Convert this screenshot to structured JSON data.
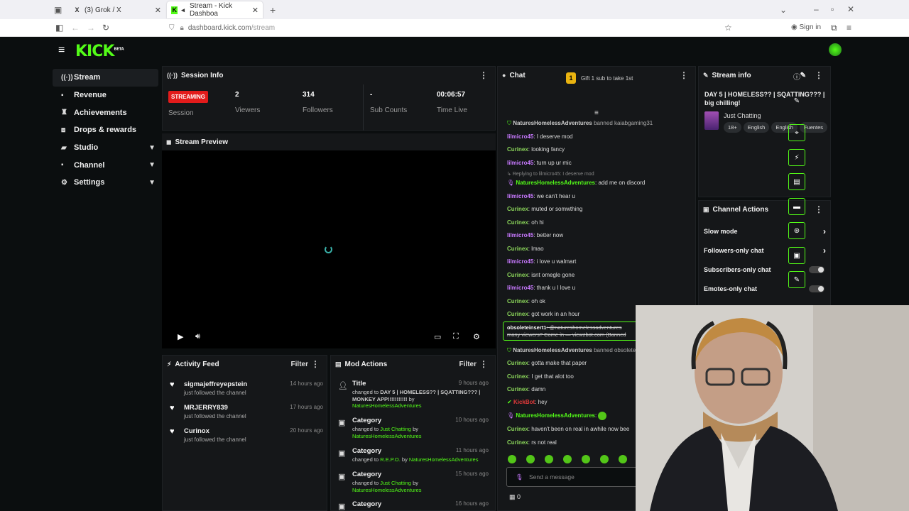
{
  "browser": {
    "tabs": [
      {
        "title": "(3) Grok / X"
      },
      {
        "title": "Stream - Kick Dashboa"
      }
    ],
    "url_host": "dashboard.kick.com",
    "url_path": "/stream",
    "sign_in": "Sign in"
  },
  "app": {
    "logo": "KICK",
    "logo_badge": "BETA"
  },
  "sidebar": {
    "items": [
      {
        "label": "Stream"
      },
      {
        "label": "Revenue"
      },
      {
        "label": "Achievements"
      },
      {
        "label": "Drops & rewards"
      },
      {
        "label": "Studio"
      },
      {
        "label": "Channel"
      },
      {
        "label": "Settings"
      }
    ]
  },
  "session": {
    "title": "Session Info",
    "status": "STREAMING",
    "session_label": "Session",
    "viewers_value": "2",
    "viewers_label": "Viewers",
    "followers_value": "314",
    "followers_label": "Followers",
    "subs_value": "-",
    "subs_label": "Sub Counts",
    "time_value": "00:06:57",
    "time_label": "Time Live"
  },
  "preview": {
    "title": "Stream Preview"
  },
  "activity": {
    "title": "Activity Feed",
    "filter": "Filter",
    "items": [
      {
        "name": "sigmajeffreyepstein",
        "sub": "just followed the channel",
        "time": "14 hours ago"
      },
      {
        "name": "MRJERRY839",
        "sub": "just followed the channel",
        "time": "17 hours ago"
      },
      {
        "name": "Curinox",
        "sub": "just followed the channel",
        "time": "20 hours ago"
      }
    ]
  },
  "mod": {
    "title": "Mod Actions",
    "filter": "Filter",
    "items": [
      {
        "title": "Title",
        "time": "9 hours ago",
        "pre": "changed to ",
        "value": "DAY 5 | HOMELESS?? | SQATTING??? | MONKEY APP!!!!!!!!!!!",
        "by": " by",
        "user": "NaturesHomelessAdventures"
      },
      {
        "title": "Category",
        "time": "10 hours ago",
        "pre": "changed to ",
        "value": "Just Chatting",
        "by": " by",
        "user": "NaturesHomelessAdventures"
      },
      {
        "title": "Category",
        "time": "11 hours ago",
        "pre": "changed to ",
        "value": "R.E.P.O.",
        "by": " by ",
        "user": "NaturesHomelessAdventures"
      },
      {
        "title": "Category",
        "time": "15 hours ago",
        "pre": "changed to ",
        "value": "Just Chatting",
        "by": " by",
        "user": "NaturesHomelessAdventures"
      },
      {
        "title": "Category",
        "time": "16 hours ago"
      }
    ]
  },
  "chat": {
    "title": "Chat",
    "gift_count": "1",
    "gift_text": "Gift 1 sub to take 1st",
    "messages": [
      {
        "user": "NaturesHomelessAdventures",
        "text": " banned ",
        "target": "kaiabgaming31",
        "type": "ban"
      },
      {
        "user": "lilmicro45",
        "text": ": I deserve mod",
        "type": "u1"
      },
      {
        "user": "Curinex",
        "text": ": looking fancy",
        "type": "u2"
      },
      {
        "user": "lilmicro45",
        "text": ": turn up ur mic",
        "type": "u1"
      },
      {
        "reply": "Replying to lilmicro45: I deserve mod",
        "user": "NaturesHomelessAdventures",
        "text": ": add me on discord",
        "type": "reply"
      },
      {
        "user": "lilmicro45",
        "text": ": we can't hear u",
        "type": "u1"
      },
      {
        "user": "Curinex",
        "text": ": muted or somwthing",
        "type": "u2"
      },
      {
        "user": "Curinex",
        "text": ": oh hi",
        "type": "u2"
      },
      {
        "user": "lilmicro45",
        "text": ": better now",
        "type": "u1"
      },
      {
        "user": "Curinex",
        "text": ": lmao",
        "type": "u2"
      },
      {
        "user": "lilmicro45",
        "text": ": i love u walmart",
        "type": "u1"
      },
      {
        "user": "Curinex",
        "text": ": isnt omegle gone",
        "type": "u2"
      },
      {
        "user": "lilmicro45",
        "text": ": thank u I love u",
        "type": "u1"
      },
      {
        "user": "Curinex",
        "text": ": oh ok",
        "type": "u2"
      },
      {
        "user": "Curinex",
        "text": ": got work in an hour",
        "type": "u2"
      },
      {
        "user": "obsoleteinsert1",
        "text": ": @natureshomelessadventures ",
        "line2": "many viewers? Come in — viewzbot.com (Banned",
        "type": "spam"
      },
      {
        "user": "NaturesHomelessAdventures",
        "text": " banned ",
        "target": "obsolete",
        "type": "ban"
      },
      {
        "user": "Curinex",
        "text": ": gotta make that paper",
        "type": "u2"
      },
      {
        "user": "Curinex",
        "text": ": I get that alot too",
        "type": "u2"
      },
      {
        "user": "Curinex",
        "text": ": damn",
        "type": "u2"
      },
      {
        "user": "KickBot",
        "text": ": hey",
        "type": "bot"
      },
      {
        "user": "NaturesHomelessAdventures",
        "text": ": ",
        "type": "emote"
      },
      {
        "user": "Curinex",
        "text": ": haven't been on real in awhile now bee",
        "type": "u2"
      },
      {
        "user": "Curinex",
        "text": ": rs not real",
        "type": "u2"
      }
    ],
    "input_placeholder": "Send a message",
    "viewer_count": "0"
  },
  "stream_info": {
    "title": "Stream info",
    "stream_title": "DAY 5 | HOMELESS?? | SQATTING??? | big chilling!",
    "category": "Just Chatting",
    "tags": [
      "18+",
      "English",
      "English",
      "Fuentes"
    ]
  },
  "channel_actions": {
    "title": "Channel Actions",
    "rows": [
      {
        "label": "Slow mode"
      },
      {
        "label": "Followers-only chat"
      },
      {
        "label": "Subscribers-only chat"
      },
      {
        "label": "Emotes-only chat"
      }
    ]
  },
  "colors": {
    "accent": "#53fc18",
    "live_red": "#e21b1b",
    "panel": "#151719",
    "background": "#0b0e0f"
  }
}
